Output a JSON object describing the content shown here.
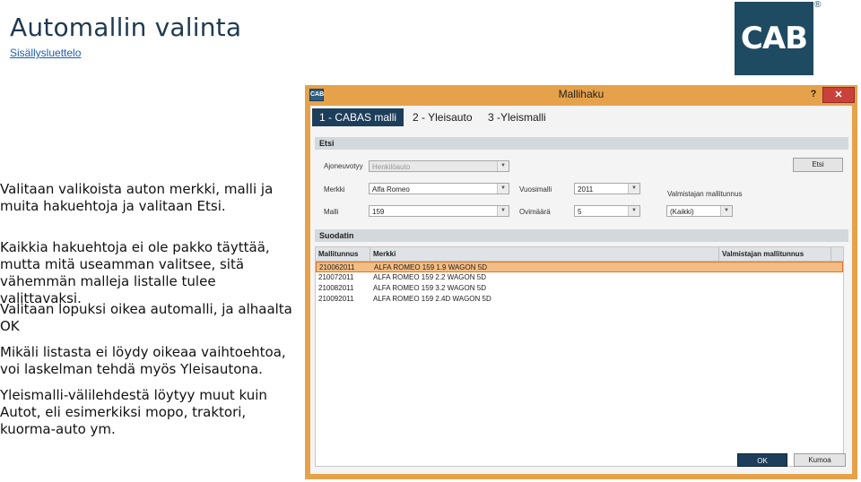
{
  "slide": {
    "title": "Automallin valinta",
    "toc_link": "Sisällysluettelo",
    "logo_text": "CAB",
    "logo_reg": "®",
    "paragraphs": [
      "Valitaan valikoista auton merkki, malli ja muita hakuehtoja ja valitaan Etsi.",
      "Kaikkia hakuehtoja ei ole pakko täyttää, mutta mitä useamman valitsee, sitä vähemmän malleja listalle tulee valittavaksi.",
      "Valitaan lopuksi oikea automalli, ja alhaalta OK",
      "Mikäli listasta ei löydy oikeaa vaihtoehtoa, voi laskelman tehdä myös Yleisautona.",
      "Yleismalli-välilehdestä löytyy muut kuin Autot, eli esimerkiksi mopo, traktori, kuorma-auto ym."
    ]
  },
  "window": {
    "title": "Mallihaku",
    "app_icon_text": "CAB",
    "help_label": "?",
    "close_label": "✕",
    "tabs": [
      {
        "label": "1 - CABAS malli",
        "active": true
      },
      {
        "label": "2 - Yleisauto",
        "active": false
      },
      {
        "label": "3 -Yleismalli",
        "active": false
      }
    ],
    "search": {
      "section_title": "Etsi",
      "ajoneuvotyyppi_label": "Ajoneuvotyy",
      "ajoneuvotyyppi_value": "Henkilöauto",
      "merkki_label": "Merkki",
      "merkki_value": "Alfa Romeo",
      "malli_label": "Malli",
      "malli_value": "159",
      "vuosimalli_label": "Vuosimalli",
      "vuosimalli_value": "2011",
      "ovimaara_label": "Ovimäärä",
      "ovimaara_value": "5",
      "valmistajan_label": "Valmistajan mallitunnus",
      "valmistajan_value": "(Kaikki)",
      "etsi_button": "Etsi"
    },
    "results": {
      "section_title": "Suodatin",
      "columns": [
        "Mallitunnus",
        "Merkki",
        "Valmistajan mallitunnus"
      ],
      "rows": [
        {
          "mallitunnus": "210062011",
          "merkki": "ALFA ROMEO 159 1.9 WAGON  5D",
          "valmistajan": "",
          "selected": true
        },
        {
          "mallitunnus": "210072011",
          "merkki": "ALFA ROMEO 159 2.2 WAGON  5D",
          "valmistajan": "",
          "selected": false
        },
        {
          "mallitunnus": "210082011",
          "merkki": "ALFA ROMEO 159 3.2 WAGON  5D",
          "valmistajan": "",
          "selected": false
        },
        {
          "mallitunnus": "210092011",
          "merkki": "ALFA ROMEO 159 2.4D WAGON  5D",
          "valmistajan": "",
          "selected": false
        }
      ]
    },
    "ok_button": "OK",
    "cancel_button": "Kumoa"
  }
}
